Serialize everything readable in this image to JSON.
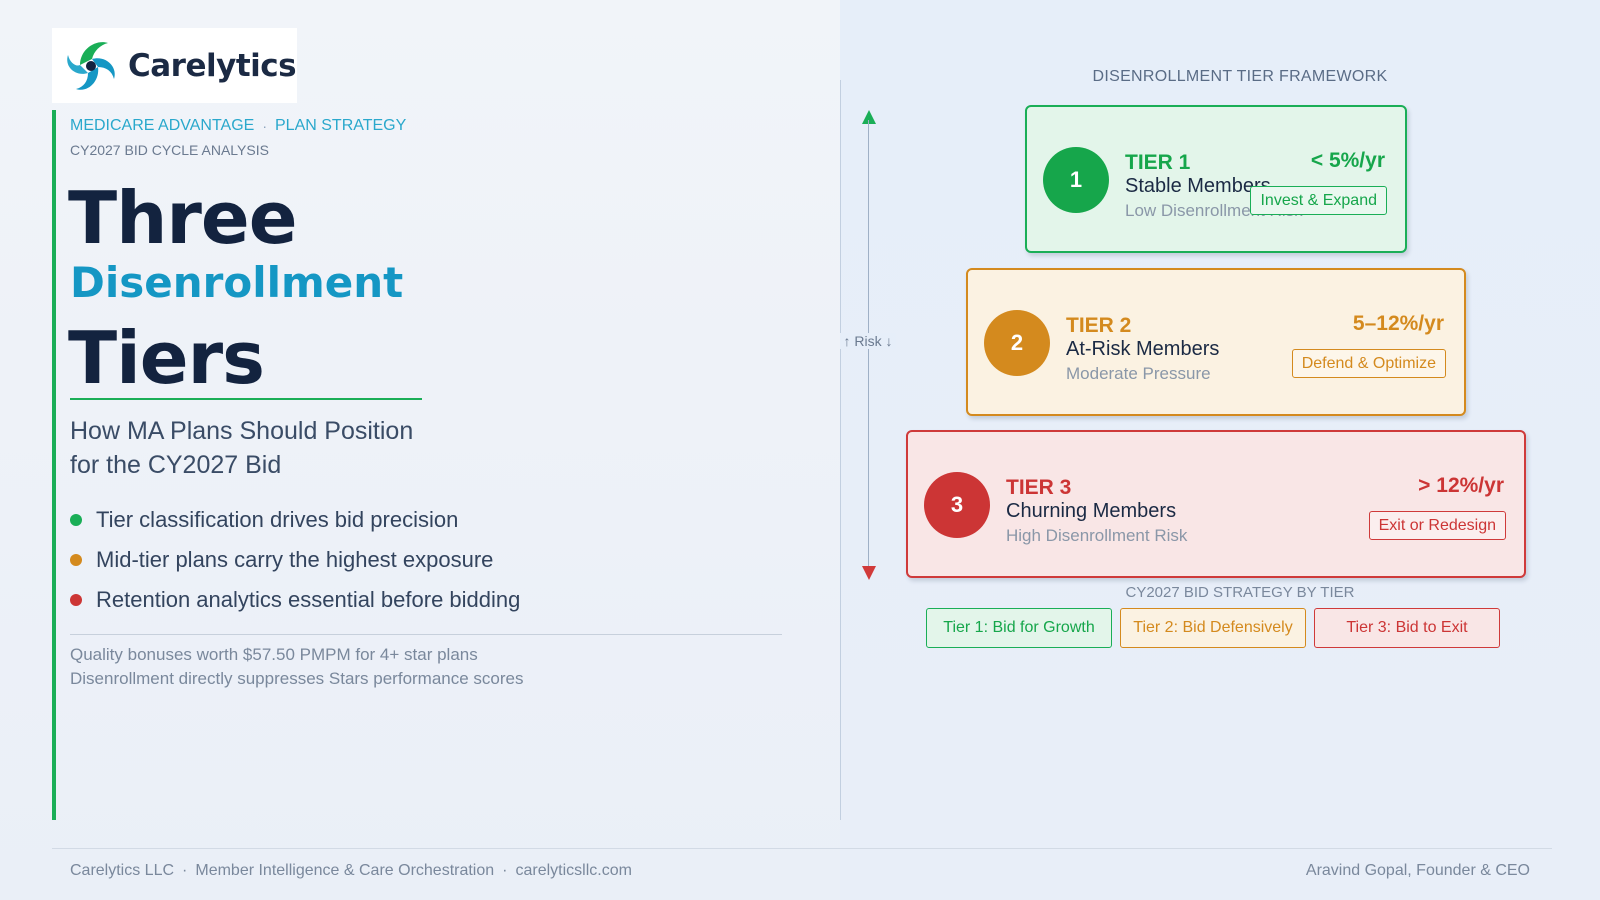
{
  "brand": {
    "name": "Carelytics"
  },
  "eyebrow": {
    "part1": "MEDICARE ADVANTAGE",
    "separator": "·",
    "part2": "PLAN STRATEGY"
  },
  "sub_eyebrow": "CY2027 BID CYCLE ANALYSIS",
  "title": {
    "line1": "Three",
    "line2": "Disenrollment",
    "line3": "Tiers"
  },
  "subtitle": {
    "line1": "How MA Plans Should Position",
    "line2": "for the CY2027 Bid"
  },
  "bullets": [
    {
      "text": "Tier classification drives bid precision",
      "color": "#1aae57"
    },
    {
      "text": "Mid-tier plans carry the highest exposure",
      "color": "#d48a1e"
    },
    {
      "text": "Retention analytics essential before bidding",
      "color": "#cc3535"
    }
  ],
  "footnotes": [
    "Quality bonuses worth $57.50 PMPM for 4+ star plans",
    "Disenrollment directly suppresses Stars performance scores"
  ],
  "framework": {
    "title": "DISENROLLMENT TIER FRAMEWORK",
    "risk_label": "↑ Risk ↓",
    "tiers": [
      {
        "number": "1",
        "name": "TIER 1",
        "members": "Stable Members",
        "risk": "Low Disenrollment Risk",
        "rate": "< 5%/yr",
        "action": "Invest & Expand",
        "color": "#16a64b"
      },
      {
        "number": "2",
        "name": "TIER 2",
        "members": "At-Risk Members",
        "risk": "Moderate Pressure",
        "rate": "5–12%/yr",
        "action": "Defend & Optimize",
        "color": "#d48a1e"
      },
      {
        "number": "3",
        "name": "TIER 3",
        "members": "Churning Members",
        "risk": "High Disenrollment Risk",
        "rate": "> 12%/yr",
        "action": "Exit or Redesign",
        "color": "#cc3535"
      }
    ]
  },
  "strategy": {
    "title": "CY2027 BID STRATEGY BY TIER",
    "buttons": [
      "Tier 1: Bid for Growth",
      "Tier 2: Bid Defensively",
      "Tier 3: Bid to Exit"
    ]
  },
  "footer": {
    "company": "Carelytics LLC",
    "tagline": "Member Intelligence & Care Orchestration",
    "website": "carelyticsllc.com",
    "separator": "·",
    "author": "Aravind Gopal, Founder & CEO"
  }
}
